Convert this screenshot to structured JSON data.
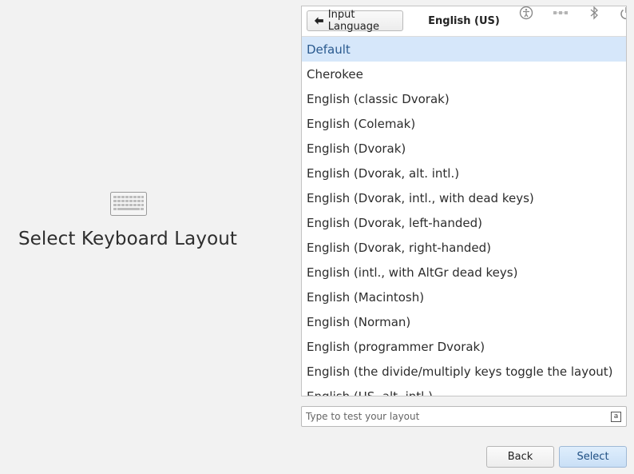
{
  "hero": {
    "icon": "keyboard-icon",
    "title": "Select Keyboard Layout"
  },
  "header": {
    "back_button_label": "Input Language",
    "back_button_icon": "arrow-left-icon",
    "title": "English (US)",
    "tray_icons": [
      "accessibility-icon",
      "network-icon",
      "bluetooth-icon",
      "power-icon"
    ]
  },
  "layouts": [
    {
      "label": "Default",
      "selected": true
    },
    {
      "label": "Cherokee"
    },
    {
      "label": "English (classic Dvorak)"
    },
    {
      "label": "English (Colemak)"
    },
    {
      "label": "English (Dvorak)"
    },
    {
      "label": "English (Dvorak, alt. intl.)"
    },
    {
      "label": "English (Dvorak, intl., with dead keys)"
    },
    {
      "label": "English (Dvorak, left-handed)"
    },
    {
      "label": "English (Dvorak, right-handed)"
    },
    {
      "label": "English (intl., with AltGr dead keys)"
    },
    {
      "label": "English (Macintosh)"
    },
    {
      "label": "English (Norman)"
    },
    {
      "label": "English (programmer Dvorak)"
    },
    {
      "label": "English (the divide/multiply keys toggle the layout)"
    },
    {
      "label": "English (US, alt. intl.)"
    }
  ],
  "test_input": {
    "placeholder": "Type to test your layout",
    "value": "",
    "indicator": "a"
  },
  "buttons": {
    "back": "Back",
    "select": "Select"
  },
  "colors": {
    "selected_row": "#d6e7fa",
    "selected_text": "#2a5a8f",
    "select_button": "#c9dff6"
  }
}
